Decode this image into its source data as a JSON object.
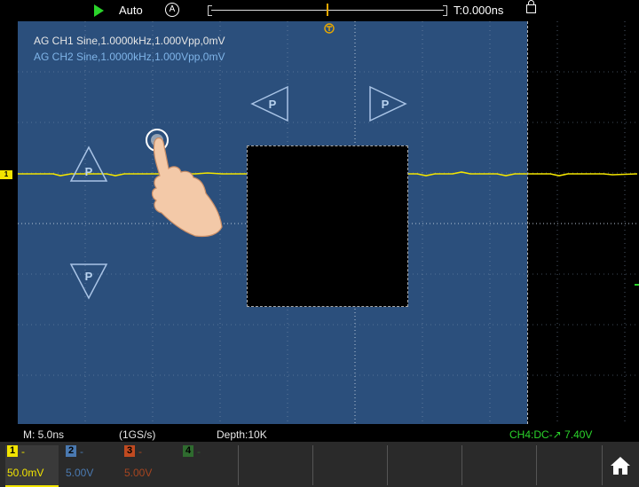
{
  "topbar": {
    "run_icon": "play-icon",
    "mode": "Auto",
    "auto_icon": "auto-measure-icon",
    "auto_icon_glyph": "A",
    "trigger_delay": "T:0.000ns",
    "lock_icon": "lock-icon"
  },
  "screen": {
    "ch1_info": "AG CH1 Sine,1.0000kHz,1.000Vpp,0mV",
    "ch2_info": "AG CH2 Sine,1.0000kHz,1.000Vpp,0mV",
    "ch1_marker": "1",
    "trigger_marker": "T",
    "p_label": "P",
    "zone_color": "#2b4f7c",
    "trace_color": "#f2e400"
  },
  "status": {
    "timebase": "M: 5.0ns",
    "sample_rate": "(1GS/s)",
    "depth": "Depth:10K",
    "trigger": "CH4:DC-↗ 7.40V"
  },
  "channels": [
    {
      "num": "1",
      "dash": "-",
      "scale": "50.0mV",
      "color": "#f2e400"
    },
    {
      "num": "2",
      "dash": "-",
      "scale": "5.00V",
      "color": "#4a79b0"
    },
    {
      "num": "3",
      "dash": "-",
      "scale": "5.00V",
      "color": "#c04a20"
    },
    {
      "num": "4",
      "dash": "-",
      "scale": "",
      "color": "#2f6b2f"
    }
  ],
  "home_icon": "home-icon"
}
